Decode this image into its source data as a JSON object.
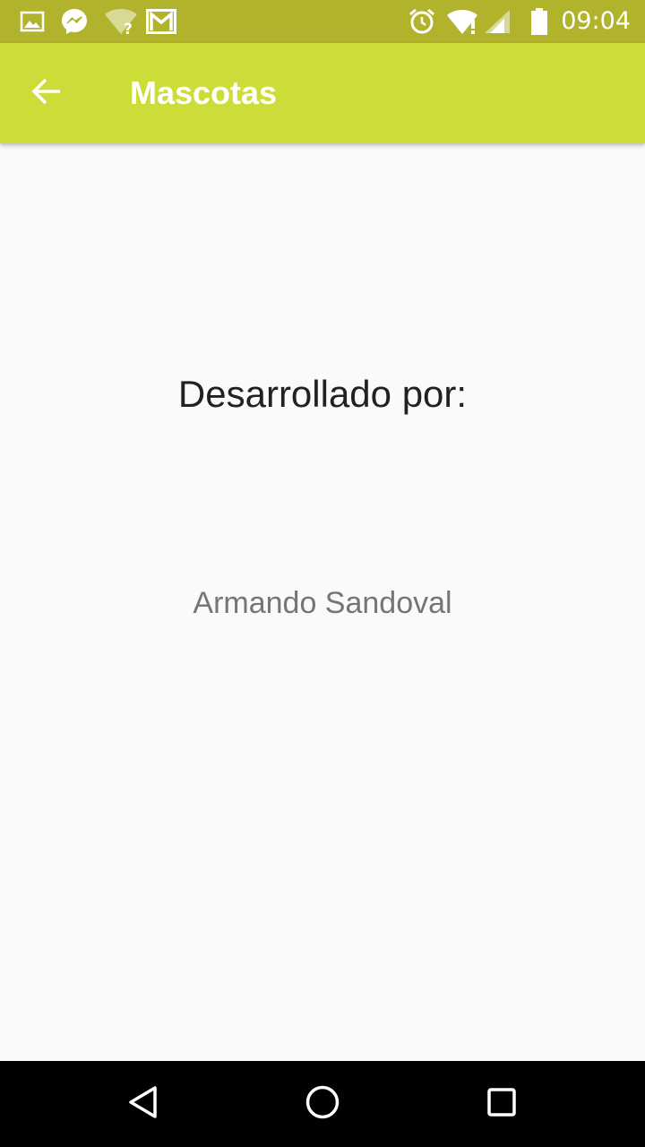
{
  "status_bar": {
    "time": "09:04",
    "left_icons": [
      "gallery-icon",
      "messenger-icon",
      "wifi-unknown-icon",
      "gmail-icon"
    ],
    "right_icons": [
      "alarm-icon",
      "wifi-alert-icon",
      "cell-signal-icon",
      "battery-icon"
    ],
    "background_color": "#b2b32c"
  },
  "app_bar": {
    "title": "Mascotas",
    "back_icon": "arrow-back-icon",
    "background_color": "#cddc39"
  },
  "main": {
    "heading": "Desarrollado por:",
    "author": "Armando Sandoval"
  },
  "nav_bar": {
    "buttons": [
      "back-triangle-icon",
      "home-circle-icon",
      "recents-square-icon"
    ]
  }
}
